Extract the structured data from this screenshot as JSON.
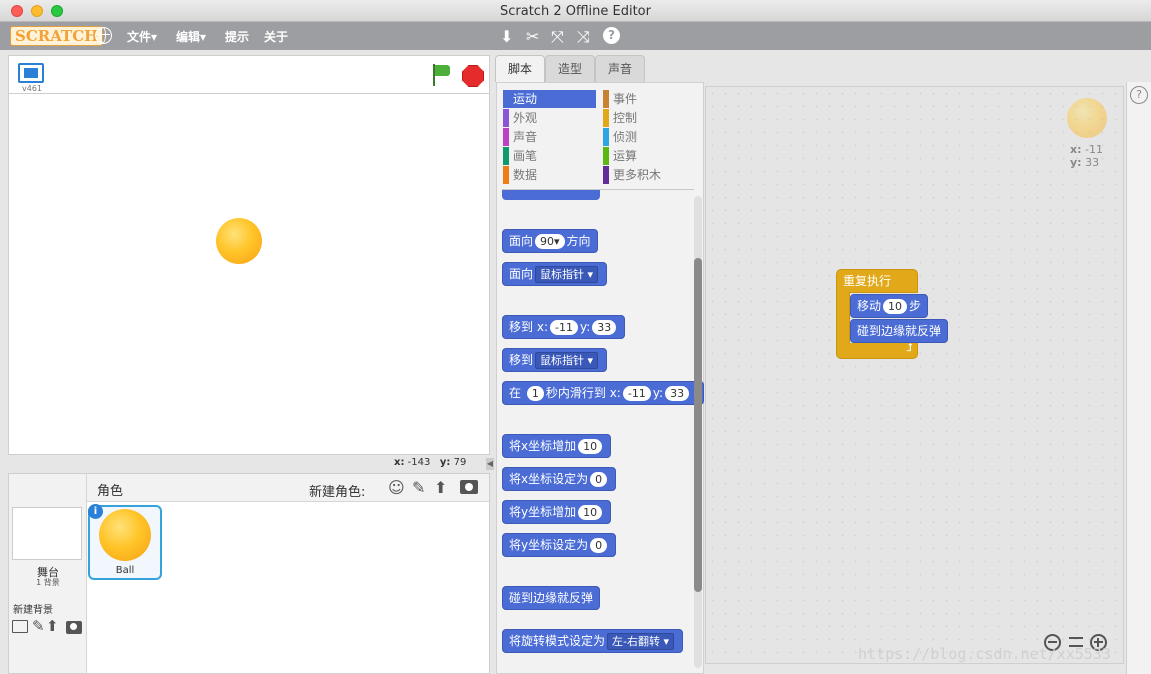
{
  "window": {
    "title": "Scratch 2 Offline Editor",
    "traffic_colors": [
      "#fd5f57",
      "#fdbc2e",
      "#29c840"
    ]
  },
  "menubar": {
    "logo": "SCRATCH",
    "items": [
      "文件▾",
      "编辑▾",
      "提示",
      "关于"
    ],
    "tool_icons": [
      "stamp-icon",
      "cut-icon",
      "grow-icon",
      "shrink-icon",
      "help-icon"
    ]
  },
  "stage": {
    "version": "v461",
    "mouse_x_label": "x:",
    "mouse_x": "-143",
    "mouse_y_label": "y:",
    "mouse_y": "79"
  },
  "sprites": {
    "header": "角色",
    "new_sprite_label": "新建角色:",
    "stage_label": "舞台",
    "stage_sub": "1 背景",
    "new_backdrop_label": "新建背景",
    "items": [
      {
        "name": "Ball"
      }
    ]
  },
  "tabs": [
    {
      "label": "脚本",
      "active": true
    },
    {
      "label": "造型",
      "active": false
    },
    {
      "label": "声音",
      "active": false
    }
  ],
  "categories": [
    {
      "label": "运动",
      "color": "#4a6cd4",
      "selected": true
    },
    {
      "label": "外观",
      "color": "#8a55d7"
    },
    {
      "label": "声音",
      "color": "#bb42c3"
    },
    {
      "label": "画笔",
      "color": "#0e9a6c"
    },
    {
      "label": "数据",
      "color": "#ee7d16"
    },
    {
      "label": "事件",
      "color": "#c88330"
    },
    {
      "label": "控制",
      "color": "#e1a91a"
    },
    {
      "label": "侦测",
      "color": "#2ca5e2"
    },
    {
      "label": "运算",
      "color": "#5cb712"
    },
    {
      "label": "更多积木",
      "color": "#632d99"
    }
  ],
  "blocks": {
    "point_dir_a": "面向",
    "point_dir_val": "90▾",
    "point_dir_b": "方向",
    "point_to_a": "面向",
    "point_to_val": "鼠标指针 ▾",
    "goto_xy_a": "移到",
    "goto_xy_x": "x:",
    "goto_xy_xval": "-11",
    "goto_xy_y": "y:",
    "goto_xy_yval": "33",
    "goto_a": "移到",
    "goto_val": "鼠标指针 ▾",
    "glide_a": "在",
    "glide_secs": "1",
    "glide_b": "秒内滑行到",
    "glide_x": "x:",
    "glide_xval": "-11",
    "glide_y": "y:",
    "glide_yval": "33",
    "changex_a": "将x坐标增加",
    "changex_val": "10",
    "setx_a": "将x坐标设定为",
    "setx_val": "0",
    "changey_a": "将y坐标增加",
    "changey_val": "10",
    "sety_a": "将y坐标设定为",
    "sety_val": "0",
    "bounce": "碰到边缘就反弹",
    "rotation_a": "将旋转模式设定为",
    "rotation_val": "左-右翻转 ▾"
  },
  "script": {
    "forever": "重复执行",
    "move_a": "移动",
    "move_val": "10",
    "move_b": "步",
    "bounce": "碰到边缘就反弹"
  },
  "sprite_info": {
    "x_label": "x:",
    "x": "-11",
    "y_label": "y:",
    "y": "33"
  },
  "zoom_icons": [
    "zoom-out-icon",
    "zoom-reset-icon",
    "zoom-in-icon"
  ],
  "help_side": "?",
  "watermark": "https://blog.csdn.net/xx5533"
}
